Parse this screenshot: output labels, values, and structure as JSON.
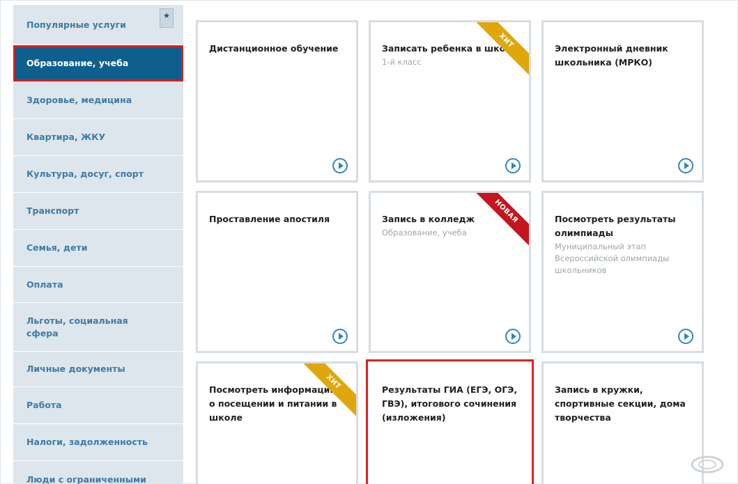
{
  "sidebar": {
    "items": [
      {
        "label": "Популярные услуги"
      },
      {
        "label": "Образование, учеба"
      },
      {
        "label": "Здоровье, медицина"
      },
      {
        "label": "Квартира, ЖКУ"
      },
      {
        "label": "Культура, досуг, спорт"
      },
      {
        "label": "Транспорт"
      },
      {
        "label": "Семья, дети"
      },
      {
        "label": "Оплата"
      },
      {
        "label": "Льготы, социальная сфера"
      },
      {
        "label": "Личные документы"
      },
      {
        "label": "Работа"
      },
      {
        "label": "Налоги, задолженность"
      },
      {
        "label": "Люди с ограниченными"
      }
    ],
    "active_index": 1,
    "star_icon": "star-icon"
  },
  "cards": [
    {
      "title": "Дистанционное обучение",
      "subtitle": ""
    },
    {
      "title": "Записать ребенка в школу",
      "subtitle": "1-й класс",
      "ribbon": "ХИТ"
    },
    {
      "title": "Электронный дневник школьника (МРКО)",
      "subtitle": ""
    },
    {
      "title": "Проставление апостиля",
      "subtitle": ""
    },
    {
      "title": "Запись в колледж",
      "subtitle": "Образование, учеба",
      "ribbon": "НОВАЯ"
    },
    {
      "title": "Посмотреть результаты олимпиады",
      "subtitle": "Муниципальный этап Всероссийской олимпиады школьников"
    },
    {
      "title": "Посмотреть информацию о посещении и питании в школе",
      "subtitle": "",
      "ribbon": "ХИТ"
    },
    {
      "title": "Результаты ГИА (ЕГЭ, ОГЭ, ГВЭ), итогового сочинения (изложения)",
      "subtitle": ""
    },
    {
      "title": "Запись в кружки, спортивные секции, дома творчества",
      "subtitle": ""
    }
  ],
  "colors": {
    "sidebar_bg": "#dde6ed",
    "sidebar_text": "#3f7aa6",
    "active_bg": "#0e5f8e",
    "highlight_border": "#e02020",
    "ribbon_hit": "#e0a70b",
    "ribbon_new": "#c4161c",
    "play_icon": "#2f86bd"
  }
}
